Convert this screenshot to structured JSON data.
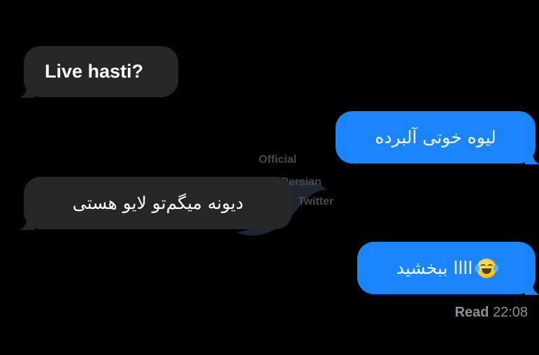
{
  "conversation": {
    "messages": [
      {
        "sender": "other",
        "text": "Live hasti?"
      },
      {
        "sender": "me",
        "text": "لیوه خوتی آلبرده"
      },
      {
        "sender": "other",
        "text": "دیونه میگم‌تو لایو هستی"
      },
      {
        "sender": "me",
        "text": "اااا ببخشید",
        "emoji": "face-with-tears-of-joy"
      }
    ],
    "status": {
      "label": "Read",
      "time": "22:08"
    }
  },
  "watermark": {
    "line1": "Official",
    "line2": "Persian",
    "line3": "Twitter",
    "icon": "bird-logo"
  },
  "colors": {
    "background": "#000000",
    "received_bubble": "#262628",
    "sent_bubble": "#1a85ff",
    "status_text": "#8e8e93"
  }
}
